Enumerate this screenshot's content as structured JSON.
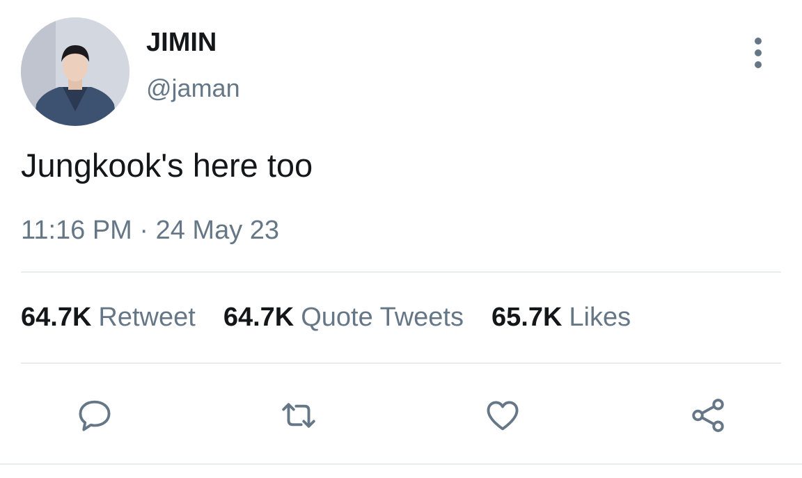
{
  "author": {
    "display_name": "JIMIN",
    "handle": "@jaman"
  },
  "tweet": {
    "text": "Jungkook's here too",
    "timestamp": "11:16 PM · 24 May 23"
  },
  "stats": [
    {
      "count": "64.7K",
      "label": "Retweet"
    },
    {
      "count": "64.7K",
      "label": "Quote Tweets"
    },
    {
      "count": "65.7K",
      "label": "Likes"
    }
  ],
  "actions": {
    "reply_icon": "reply-icon",
    "retweet_icon": "retweet-icon",
    "like_icon": "heart-icon",
    "share_icon": "share-icon"
  },
  "colors": {
    "primary_text": "#14171a",
    "secondary_text": "#657786",
    "divider": "#e6ecf0"
  }
}
